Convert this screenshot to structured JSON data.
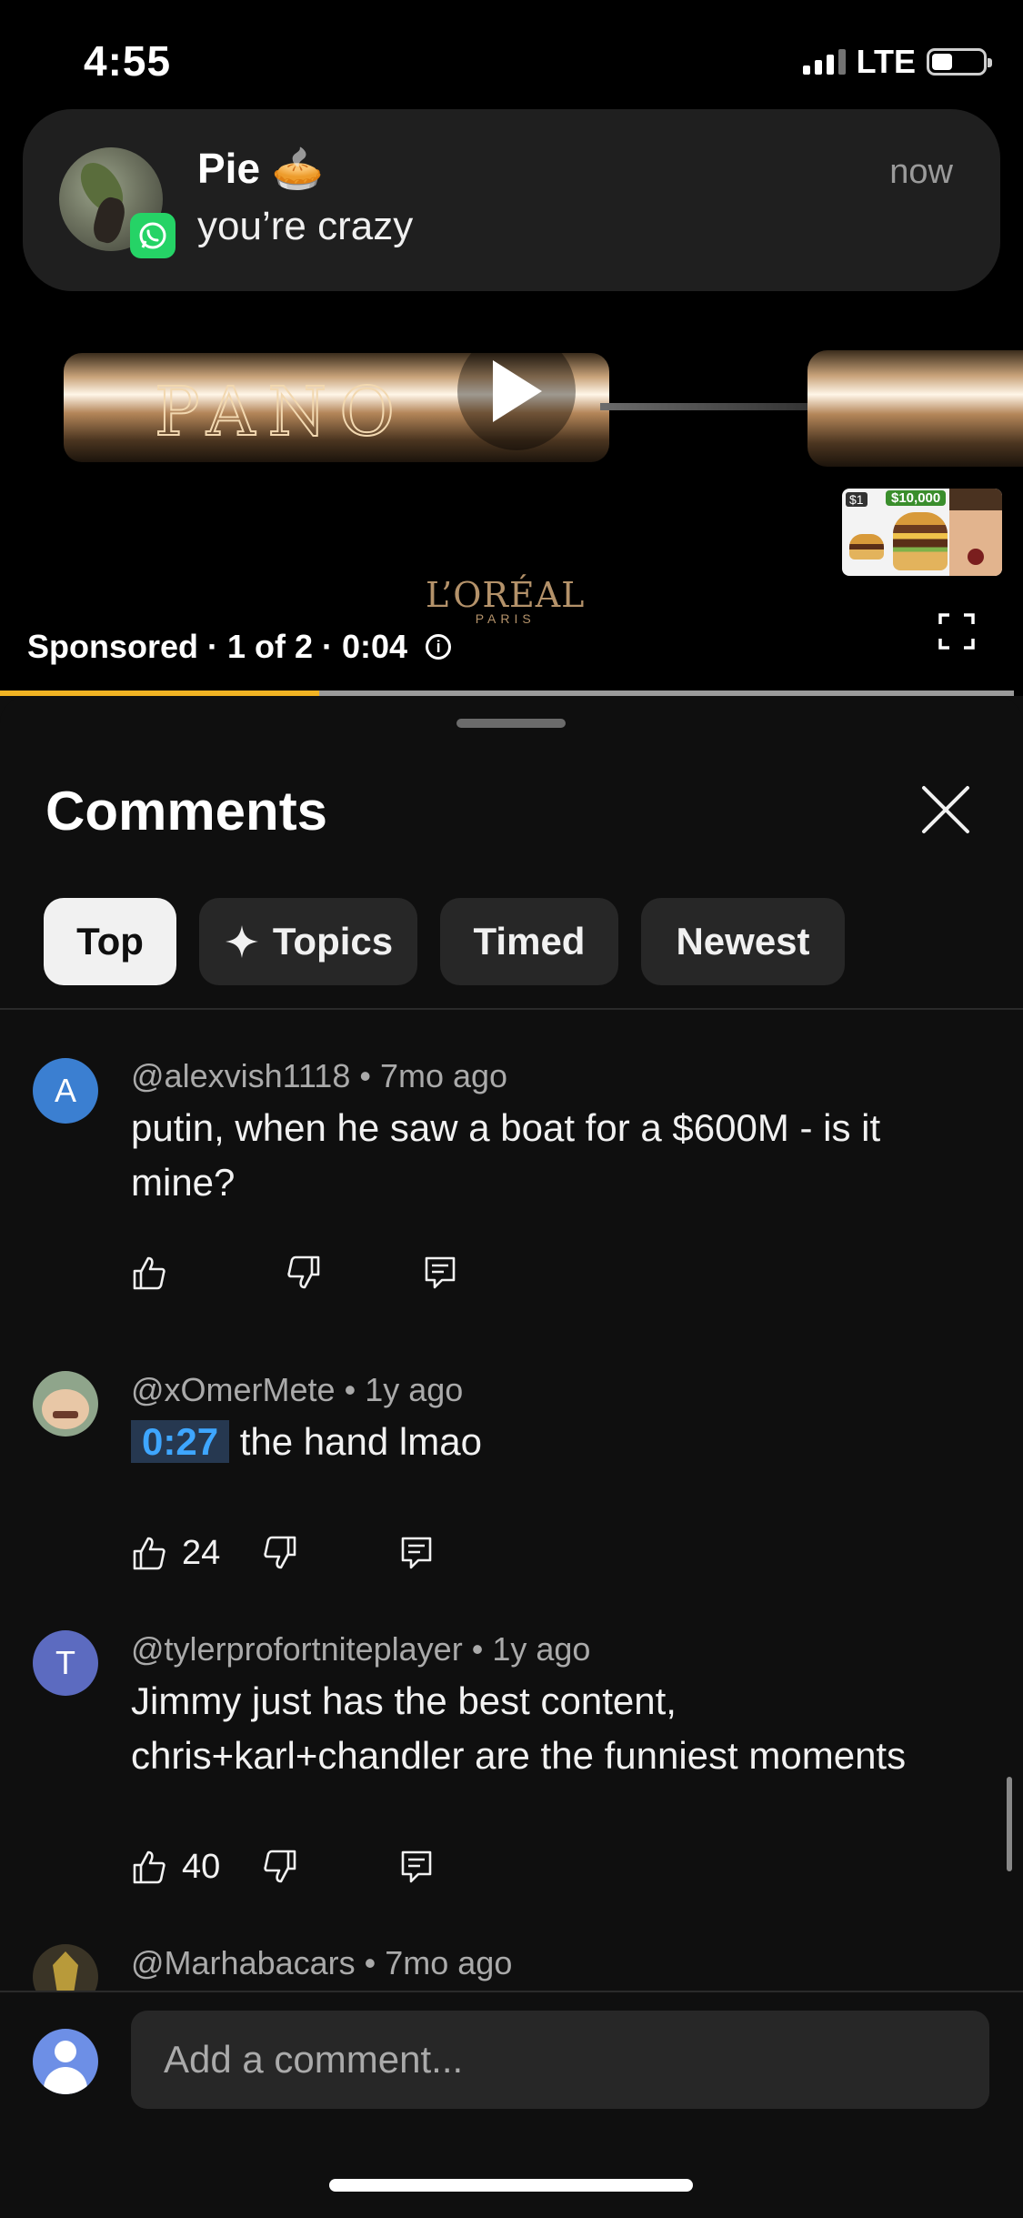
{
  "status_bar": {
    "time": "4:55",
    "network": "LTE"
  },
  "notification": {
    "sender": "Pie",
    "emoji": "🥧",
    "message": "you’re crazy",
    "time": "now",
    "app_icon": "whatsapp-icon"
  },
  "ad": {
    "brand": "L’ORÉAL",
    "brand_sub": "PARIS",
    "sponsored_text": "Sponsored · 1 of 2 · 0:04",
    "progress": 0.315,
    "thumbnail_labels": [
      "$1",
      "$10,000"
    ]
  },
  "comments_panel": {
    "title": "Comments",
    "tabs": [
      {
        "label": "Top",
        "active": true
      },
      {
        "label": "Topics",
        "active": false,
        "icon": "sparkle-icon"
      },
      {
        "label": "Timed",
        "active": false
      },
      {
        "label": "Newest",
        "active": false
      }
    ],
    "comments": [
      {
        "avatar_letter": "A",
        "avatar_color": "#3b7fd1",
        "author": "@alexvish1118",
        "age": "7mo ago",
        "text": "putin, when he saw a boat for a $600M - is it mine?",
        "likes": ""
      },
      {
        "avatar_letter": "",
        "avatar_color": "#8fa58b",
        "author": "@xOmerMete",
        "age": "1y ago",
        "timestamp": "0:27",
        "text": "the hand lmao",
        "likes": "24"
      },
      {
        "avatar_letter": "T",
        "avatar_color": "#5c6bc0",
        "author": "@tylerprofortniteplayer",
        "age": "1y ago",
        "text": "Jimmy just has the best content, chris+karl+chandler are the funniest moments",
        "likes": "40"
      },
      {
        "avatar_letter": "",
        "avatar_color": "#3a3426",
        "author": "@Marhabacars",
        "age": "7mo ago",
        "text": "",
        "likes": ""
      }
    ],
    "input_placeholder": "Add a comment..."
  },
  "colors": {
    "progress": "#f0b323",
    "background": "#0f0f0f",
    "chip": "#272727",
    "link": "#3ea6ff"
  }
}
